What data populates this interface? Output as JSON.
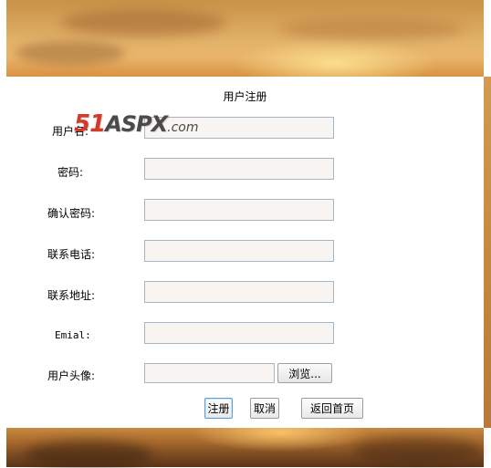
{
  "form": {
    "title": "用户注册",
    "fields": [
      {
        "label": "用户名:",
        "value": ""
      },
      {
        "label": "密码:",
        "value": ""
      },
      {
        "label": "确认密码:",
        "value": ""
      },
      {
        "label": "联系电话:",
        "value": ""
      },
      {
        "label": "联系地址:",
        "value": ""
      },
      {
        "label": "Emial:",
        "value": ""
      }
    ],
    "avatar": {
      "label": "用户头像:",
      "value": "",
      "browse_label": "浏览..."
    },
    "buttons": {
      "register": "注册",
      "cancel": "取消",
      "home": "返回首页"
    }
  },
  "watermark": {
    "number": "51",
    "brand": "ASPX",
    "suffix": ".com"
  }
}
